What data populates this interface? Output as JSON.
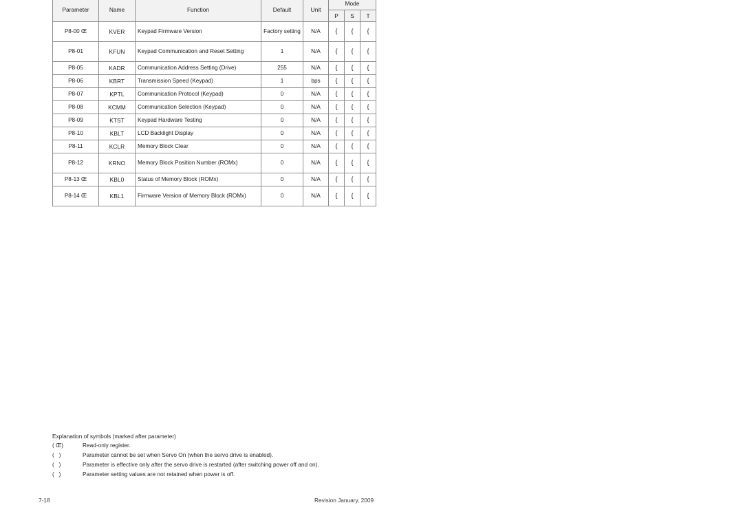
{
  "table": {
    "headers": {
      "parameter": "Parameter",
      "name": "Name",
      "function": "Function",
      "default": "Default",
      "unit": "Unit",
      "mode": "Mode",
      "mode_p": "P",
      "mode_s": "S",
      "mode_t": "T"
    },
    "rows": [
      {
        "parameter": "P8-00 Œ",
        "name": "KVER",
        "function": "Keypad Firmware Version",
        "default": "Factory setting",
        "unit": "N/A",
        "mode_p": "{",
        "mode_s": "{",
        "mode_t": "{"
      },
      {
        "parameter": "P8-01",
        "name": "KFUN",
        "function": "Keypad Communication and Reset Setting",
        "default": "1",
        "unit": "N/A",
        "mode_p": "{",
        "mode_s": "{",
        "mode_t": "{"
      },
      {
        "parameter": "P8-05",
        "name": "KADR",
        "function": "Communication Address Setting (Drive)",
        "default": "255",
        "unit": "N/A",
        "mode_p": "{",
        "mode_s": "{",
        "mode_t": "{"
      },
      {
        "parameter": "P8-06",
        "name": "KBRT",
        "function": "Transmission Speed (Keypad)",
        "default": "1",
        "unit": "bps",
        "mode_p": "{",
        "mode_s": "{",
        "mode_t": "{"
      },
      {
        "parameter": "P8-07",
        "name": "KPTL",
        "function": "Communication Protocol (Keypad)",
        "default": "0",
        "unit": "N/A",
        "mode_p": "{",
        "mode_s": "{",
        "mode_t": "{"
      },
      {
        "parameter": "P8-08",
        "name": "KCMM",
        "function": "Communication Selection (Keypad)",
        "default": "0",
        "unit": "N/A",
        "mode_p": "{",
        "mode_s": "{",
        "mode_t": "{"
      },
      {
        "parameter": "P8-09",
        "name": "KTST",
        "function": "Keypad Hardware Testing",
        "default": "0",
        "unit": "N/A",
        "mode_p": "{",
        "mode_s": "{",
        "mode_t": "{"
      },
      {
        "parameter": "P8-10",
        "name": "KBLT",
        "function": "LCD Backlight Display",
        "default": "0",
        "unit": "N/A",
        "mode_p": "{",
        "mode_s": "{",
        "mode_t": "{"
      },
      {
        "parameter": "P8-11",
        "name": "KCLR",
        "function": "Memory Block Clear",
        "default": "0",
        "unit": "N/A",
        "mode_p": "{",
        "mode_s": "{",
        "mode_t": "{"
      },
      {
        "parameter": "P8-12",
        "name": "KRNO",
        "function": "Memory Block Position Number (ROMx)",
        "default": "0",
        "unit": "N/A",
        "mode_p": "{",
        "mode_s": "{",
        "mode_t": "{"
      },
      {
        "parameter": "P8-13 Œ",
        "name": "KBL0",
        "function": "Status of Memory Block (ROMx)",
        "default": "0",
        "unit": "N/A",
        "mode_p": "{",
        "mode_s": "{",
        "mode_t": "{"
      },
      {
        "parameter": "P8-14 Œ",
        "name": "KBL1",
        "function": "Firmware Version of Memory Block (ROMx)",
        "default": "0",
        "unit": "N/A",
        "mode_p": "{",
        "mode_s": "{",
        "mode_t": "{"
      }
    ]
  },
  "legend": {
    "title": "Explanation of symbols (marked after parameter)",
    "entries": [
      {
        "symbol": "( Œ)",
        "text": "Read-only register."
      },
      {
        "symbol": "(   )",
        "text": "Parameter cannot be set when Servo On (when the servo drive is enabled)."
      },
      {
        "symbol": "(   )",
        "text": "Parameter is effective only after the servo drive is restarted (after switching power off and on)."
      },
      {
        "symbol": "(   )",
        "text": "Parameter setting values are not retained when power is off."
      }
    ]
  },
  "footer": {
    "page_number": "7-18",
    "revision": "Revision January, 2009"
  }
}
